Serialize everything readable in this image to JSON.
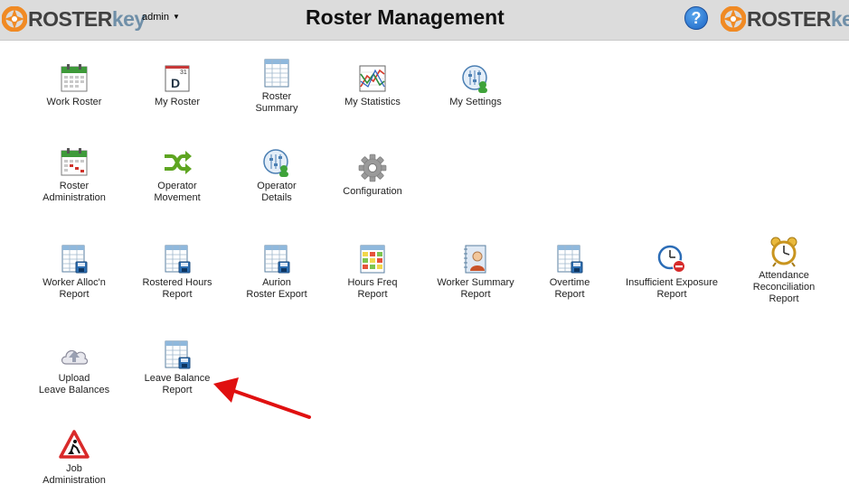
{
  "header": {
    "logo_left": {
      "part1": "ROSTER",
      "part2": "key"
    },
    "user_menu": "admin",
    "title": "Roster Management",
    "help_label": "?",
    "logo_right": {
      "part1": "ROSTER",
      "part2": "key"
    }
  },
  "colors": {
    "header_bg": "#dcdcdc",
    "logo_orange": "#f08a24",
    "logo_dark": "#404040",
    "logo_blue": "#6f8fa8",
    "help_blue": "#1b64c4",
    "arrow_red": "#e01010"
  },
  "tiles": [
    {
      "label1": "Work Roster",
      "label2": "",
      "icon": "calendar-green-icon"
    },
    {
      "label1": "My Roster",
      "label2": "",
      "icon": "daily-calendar-icon"
    },
    {
      "label1": "Roster",
      "label2": "Summary",
      "icon": "spreadsheet-icon"
    },
    {
      "label1": "My Statistics",
      "label2": "",
      "icon": "statistics-chart-icon"
    },
    {
      "label1": "My Settings",
      "label2": "",
      "icon": "user-settings-icon"
    },
    {
      "label1": "Roster",
      "label2": "Administration",
      "icon": "calendar-admin-icon"
    },
    {
      "label1": "Operator",
      "label2": "Movement",
      "icon": "shuffle-arrows-icon"
    },
    {
      "label1": "Operator",
      "label2": "Details",
      "icon": "operator-details-icon"
    },
    {
      "label1": "Configuration",
      "label2": "",
      "icon": "gear-icon"
    },
    {
      "label1": "Worker Alloc'n",
      "label2": "Report",
      "icon": "report-disk-icon"
    },
    {
      "label1": "Rostered Hours",
      "label2": "Report",
      "icon": "report-disk-icon"
    },
    {
      "label1": "Aurion",
      "label2": "Roster Export",
      "icon": "report-disk-icon"
    },
    {
      "label1": "Hours Freq",
      "label2": "Report",
      "icon": "heatmap-report-icon"
    },
    {
      "label1": "Worker Summary",
      "label2": "Report",
      "icon": "worker-summary-icon"
    },
    {
      "label1": "Overtime",
      "label2": "Report",
      "icon": "report-disk-icon"
    },
    {
      "label1": "Insufficient Exposure",
      "label2": "Report",
      "icon": "clock-stop-icon"
    },
    {
      "label1": "Attendance",
      "label2": "Reconciliation",
      "label3": "Report",
      "icon": "alarm-clock-icon"
    },
    {
      "label1": "Upload",
      "label2": "Leave Balances",
      "icon": "cloud-upload-icon"
    },
    {
      "label1": "Leave Balance",
      "label2": "Report",
      "icon": "report-disk-icon"
    },
    {
      "label1": "Job",
      "label2": "Administration",
      "icon": "road-works-icon"
    }
  ]
}
